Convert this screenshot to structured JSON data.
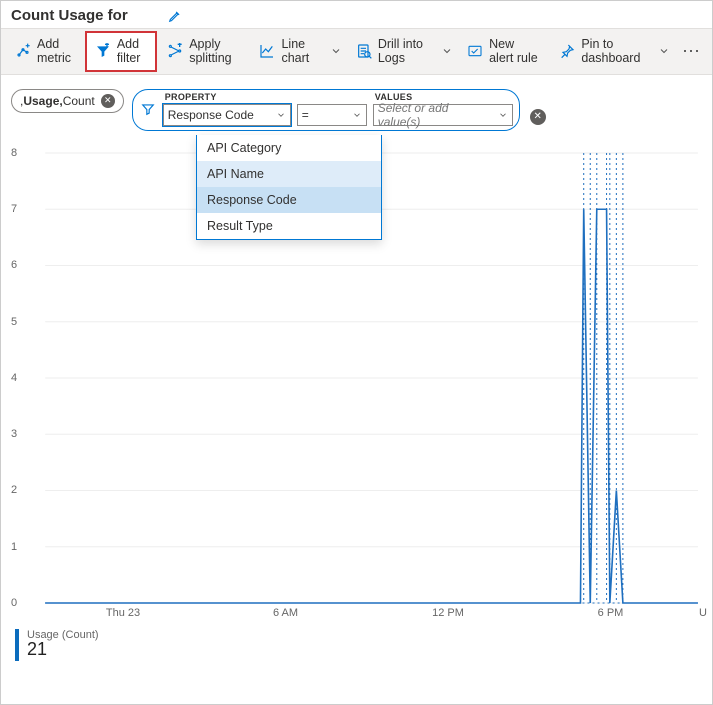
{
  "title": "Count Usage for",
  "toolbar": {
    "add_metric": "Add metric",
    "add_filter": "Add filter",
    "apply_splitting": "Apply splitting",
    "line_chart": "Line chart",
    "drill_logs": "Drill into Logs",
    "new_alert": "New alert rule",
    "pin_dashboard": "Pin to dashboard"
  },
  "metric_pill": {
    "prefix": ", ",
    "metric": "Usage,",
    "agg": " Count"
  },
  "filter": {
    "labels": {
      "property": "PROPERTY",
      "values": "VALUES"
    },
    "property_value": "Response Code",
    "operator": "=",
    "values_placeholder": "Select or add value(s)",
    "dropdown": [
      "API Category",
      "API Name",
      "Response Code",
      "Result Type"
    ],
    "dropdown_hover": "API Name",
    "dropdown_selected": "Response Code"
  },
  "chart_data": {
    "type": "line",
    "title": "",
    "xlabel": "",
    "ylabel": "",
    "ylim": [
      0,
      8
    ],
    "yticks": [
      0,
      1,
      2,
      3,
      4,
      5,
      6,
      7,
      8
    ],
    "x_categories": [
      "Thu 23",
      "6 AM",
      "12 PM",
      "6 PM"
    ],
    "x_right_cut": "U",
    "series": [
      {
        "name": "Usage (Count)",
        "color": "#1f6fbf",
        "points": [
          {
            "x": 0.0,
            "y": 0
          },
          {
            "x": 0.82,
            "y": 0
          },
          {
            "x": 0.825,
            "y": 7
          },
          {
            "x": 0.835,
            "y": 0
          },
          {
            "x": 0.845,
            "y": 7
          },
          {
            "x": 0.86,
            "y": 7
          },
          {
            "x": 0.865,
            "y": 0
          },
          {
            "x": 0.875,
            "y": 2
          },
          {
            "x": 0.885,
            "y": 0
          },
          {
            "x": 1.0,
            "y": 0
          }
        ]
      }
    ]
  },
  "legend": {
    "name": "Usage (Count)",
    "value": "21"
  }
}
